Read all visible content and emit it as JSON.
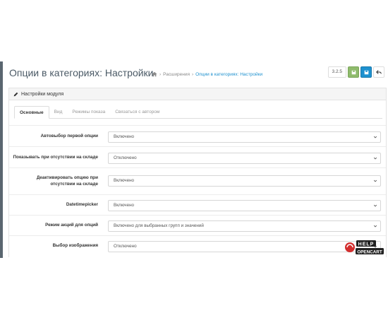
{
  "header": {
    "title": "Опции в категориях: Настройки",
    "breadcrumb": [
      "Расширения",
      "Опции в категориях: Настройки"
    ],
    "version": "3.2.5"
  },
  "panel": {
    "heading": "Настройки модуля",
    "tabs": [
      "Основные",
      "Вид",
      "Режимы показа",
      "Связаться с автором"
    ]
  },
  "form": {
    "rows": [
      {
        "label": "Автовыбор первой опции",
        "value": "Включено"
      },
      {
        "label": "Показывать при отсутствии на складе",
        "value": "Отключено"
      },
      {
        "label": "Деактивировать опцию при отсутствии на складе",
        "value": "Включено"
      },
      {
        "label": "Datetimepicker",
        "value": "Включено"
      },
      {
        "label": "Режим акций для опций",
        "value": "Включено для выбранных групп и значений"
      },
      {
        "label": "Выбор изображения",
        "value": "Отключено"
      }
    ]
  },
  "badge": {
    "line1": "HELP",
    "line2": "OPENCART"
  },
  "colors": {
    "accent": "#1e91cf",
    "save": "#8fbb6c",
    "title": "#4b5a66"
  },
  "icons": [
    "home-icon",
    "pencil-icon",
    "save-icon",
    "save-stay-icon",
    "back-icon",
    "chevron-down-icon"
  ]
}
